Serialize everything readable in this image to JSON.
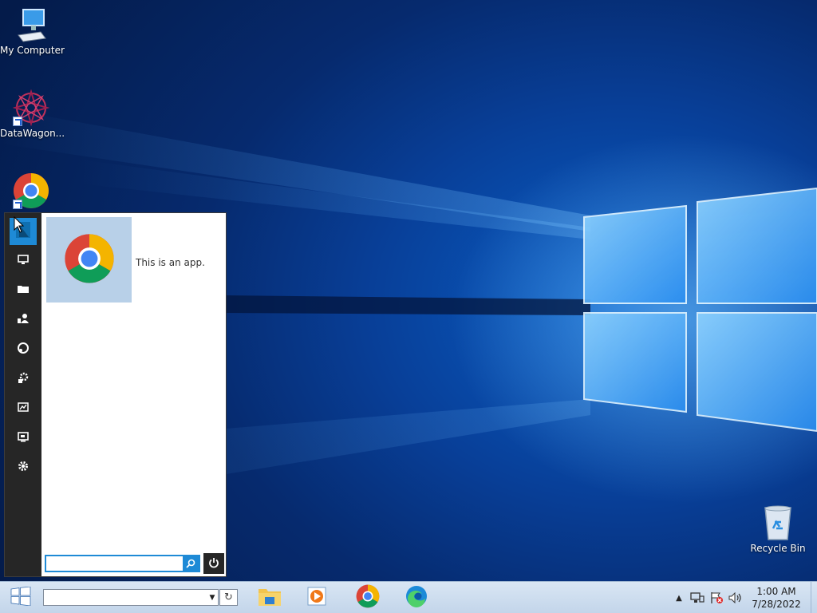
{
  "desktop": {
    "icons": [
      {
        "label": "My Computer",
        "icon": "computer-icon"
      },
      {
        "label": "DataWagon...",
        "icon": "datawagon-icon"
      },
      {
        "label": "",
        "icon": "chrome-icon"
      },
      {
        "label": "Recycle Bin",
        "icon": "recycle-bin-icon"
      }
    ]
  },
  "start_menu": {
    "rail_items": [
      {
        "icon": "apps-icon",
        "active": true
      },
      {
        "icon": "monitor-icon"
      },
      {
        "icon": "folder-icon"
      },
      {
        "icon": "user-icon"
      },
      {
        "icon": "network-icon"
      },
      {
        "icon": "admin-tools-icon"
      },
      {
        "icon": "performance-icon"
      },
      {
        "icon": "remote-desktop-icon"
      },
      {
        "icon": "settings-icon"
      }
    ],
    "tile": {
      "icon": "chrome-icon",
      "description": "This is an app."
    },
    "search": {
      "value": "",
      "placeholder": ""
    },
    "power_icon": "power-icon"
  },
  "taskbar": {
    "search": {
      "value": "",
      "placeholder": ""
    },
    "refresh_glyph": "↻",
    "apps": [
      "file-explorer-icon",
      "media-player-icon",
      "chrome-icon",
      "edge-icon"
    ],
    "tray": {
      "time": "1:00 AM",
      "date": "7/28/2022",
      "icons": [
        "tray-overflow-icon",
        "network-icon",
        "action-center-flag-icon",
        "volume-icon"
      ]
    }
  },
  "colors": {
    "accent": "#1e8ad6",
    "rail": "#262626",
    "taskbar": "#c9dbee"
  }
}
